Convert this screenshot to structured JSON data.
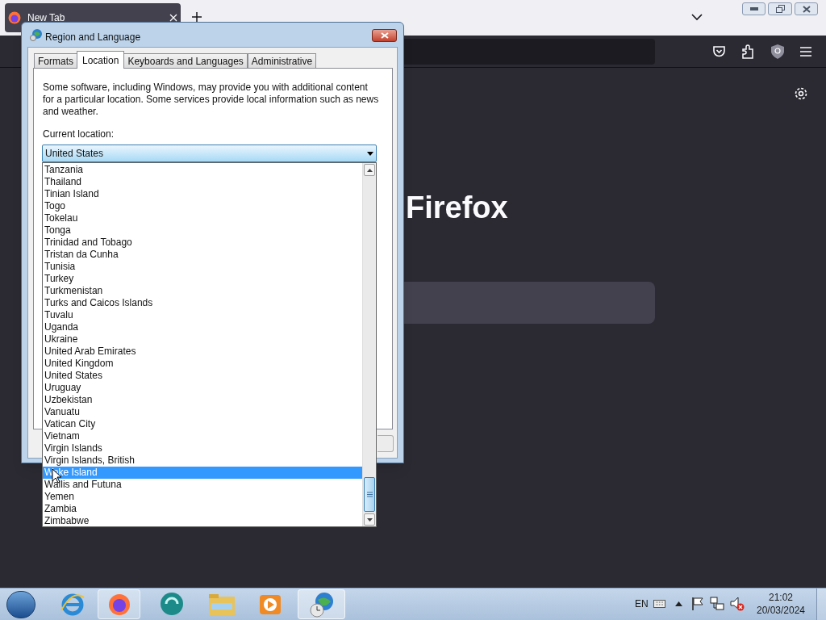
{
  "browser": {
    "tabs": [
      {
        "label": "New Tab",
        "selected": true
      }
    ],
    "brand": "Firefox"
  },
  "dialog": {
    "title": "Region and Language",
    "tabs": [
      {
        "label": "Formats",
        "selected": false
      },
      {
        "label": "Location",
        "selected": true
      },
      {
        "label": "Keyboards and Languages",
        "selected": false
      },
      {
        "label": "Administrative",
        "selected": false
      }
    ],
    "description": "Some software, including Windows, may provide you with additional content for a particular location. Some services provide local information such as news and weather.",
    "location_label": "Current location:",
    "location_value": "United States",
    "options": [
      {
        "label": "Tanzania",
        "selected": false
      },
      {
        "label": "Thailand",
        "selected": false
      },
      {
        "label": "Tinian Island",
        "selected": false
      },
      {
        "label": "Togo",
        "selected": false
      },
      {
        "label": "Tokelau",
        "selected": false
      },
      {
        "label": "Tonga",
        "selected": false
      },
      {
        "label": "Trinidad and Tobago",
        "selected": false
      },
      {
        "label": "Tristan da Cunha",
        "selected": false
      },
      {
        "label": "Tunisia",
        "selected": false
      },
      {
        "label": "Turkey",
        "selected": false
      },
      {
        "label": "Turkmenistan",
        "selected": false
      },
      {
        "label": "Turks and Caicos Islands",
        "selected": false
      },
      {
        "label": "Tuvalu",
        "selected": false
      },
      {
        "label": "Uganda",
        "selected": false
      },
      {
        "label": "Ukraine",
        "selected": false
      },
      {
        "label": "United Arab Emirates",
        "selected": false
      },
      {
        "label": "United Kingdom",
        "selected": false
      },
      {
        "label": "United States",
        "selected": false
      },
      {
        "label": "Uruguay",
        "selected": false
      },
      {
        "label": "Uzbekistan",
        "selected": false
      },
      {
        "label": "Vanuatu",
        "selected": false
      },
      {
        "label": "Vatican City",
        "selected": false
      },
      {
        "label": "Vietnam",
        "selected": false
      },
      {
        "label": "Virgin Islands",
        "selected": false
      },
      {
        "label": "Virgin Islands, British",
        "selected": false
      },
      {
        "label": "Wake Island",
        "selected": true
      },
      {
        "label": "Wallis and Futuna",
        "selected": false
      },
      {
        "label": "Yemen",
        "selected": false
      },
      {
        "label": "Zambia",
        "selected": false
      },
      {
        "label": "Zimbabwe",
        "selected": false
      }
    ]
  },
  "taskbar": {
    "language": "EN",
    "time": "21:02",
    "date": "20/03/2024"
  }
}
